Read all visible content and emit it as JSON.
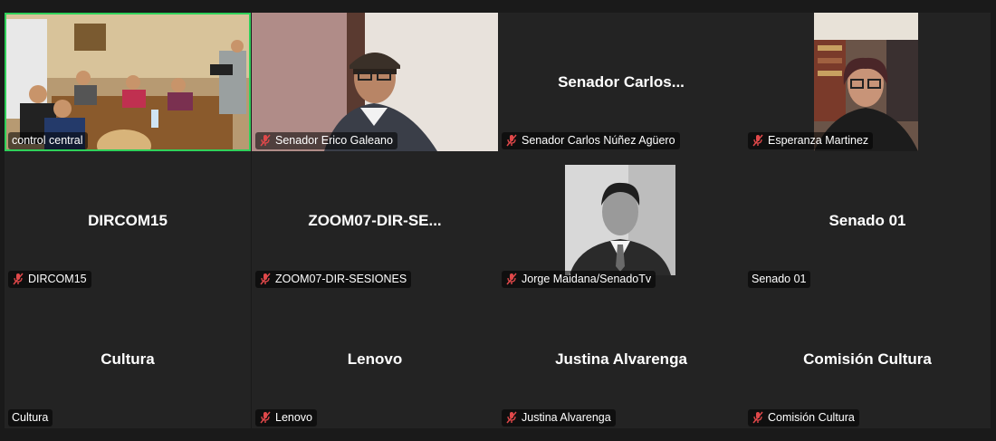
{
  "colors": {
    "background": "#1a1a1a",
    "tile": "#232323",
    "active_border": "#2fd05a",
    "muted": "#e0484a"
  },
  "participants": [
    {
      "name": "control central",
      "display": "",
      "muted": false,
      "video": "meeting-room"
    },
    {
      "name": "Senador Erico Galeano",
      "display": "",
      "muted": true,
      "video": "man-cap"
    },
    {
      "name": "Senador Carlos Núñez Agüero",
      "display": "Senador  Carlos...",
      "muted": true,
      "video": ""
    },
    {
      "name": "Esperanza Martinez",
      "display": "",
      "muted": true,
      "video": "woman-glasses"
    },
    {
      "name": "DIRCOM15",
      "display": "DIRCOM15",
      "muted": true,
      "video": ""
    },
    {
      "name": "ZOOM07-DIR-SESIONES",
      "display": "ZOOM07-DIR-SE...",
      "muted": true,
      "video": ""
    },
    {
      "name": "Jorge Maidana/SenadoTv",
      "display": "",
      "muted": true,
      "video": "portrait-bw"
    },
    {
      "name": "Senado 01",
      "display": "Senado 01",
      "muted": false,
      "video": ""
    },
    {
      "name": "Cultura",
      "display": "Cultura",
      "muted": false,
      "video": ""
    },
    {
      "name": "Lenovo",
      "display": "Lenovo",
      "muted": true,
      "video": ""
    },
    {
      "name": "Justina Alvarenga",
      "display": "Justina Alvarenga",
      "muted": true,
      "video": ""
    },
    {
      "name": "Comisión Cultura",
      "display": "Comisión Cultura",
      "muted": true,
      "video": ""
    }
  ]
}
